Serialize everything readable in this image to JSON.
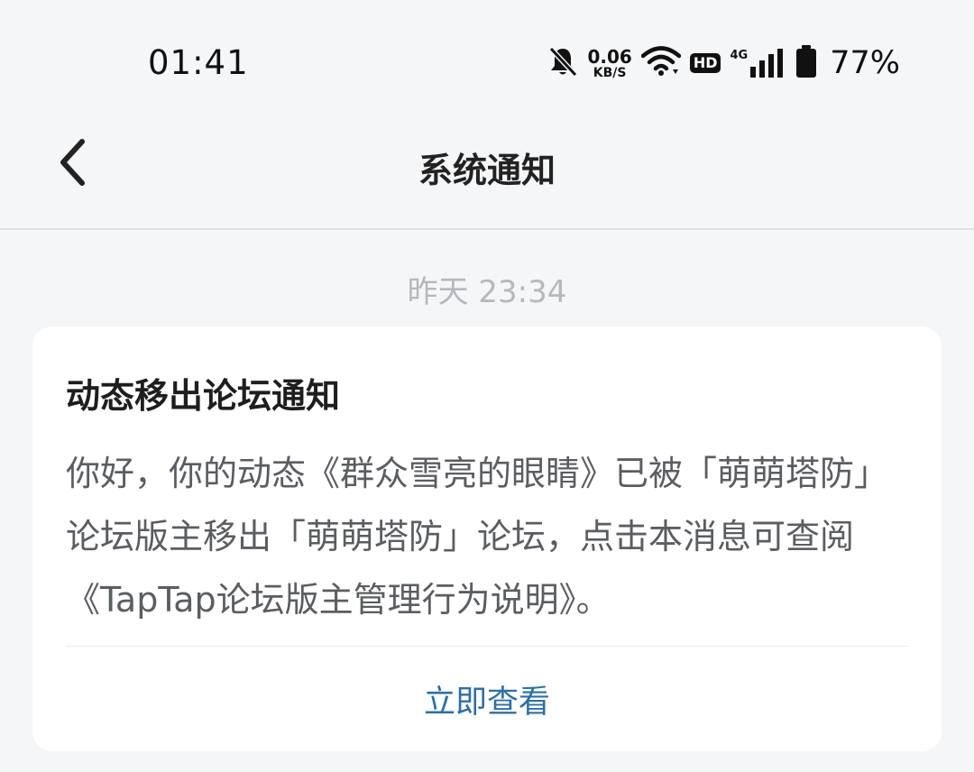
{
  "status_bar": {
    "time": "01:41",
    "net_speed_value": "0.06",
    "net_speed_unit": "KB/S",
    "hd_label": "HD",
    "network_type": "4G",
    "battery_percent": "77%",
    "icons": [
      "bell-muted-icon",
      "wifi-icon",
      "signal-icon",
      "battery-icon"
    ]
  },
  "nav": {
    "back_icon": "chevron-left-icon",
    "title": "系统通知"
  },
  "message": {
    "timestamp": "昨天  23:34",
    "title": "动态移出论坛通知",
    "body": "你好，你的动态《群众雪亮的眼睛》已被「萌萌塔防」论坛版主移出「萌萌塔防」论坛，点击本消息可查阅《TapTap论坛版主管理行为说明》。",
    "action_label": "立即查看",
    "action_color": "#2b6fa8"
  }
}
